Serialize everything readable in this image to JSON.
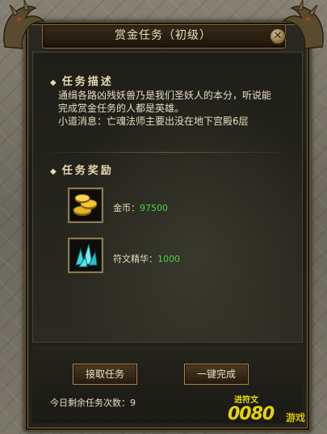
{
  "window": {
    "title": "赏金任务（初级）",
    "close_glyph": "✕"
  },
  "description": {
    "header": "任务描述",
    "lines": [
      "通缉各路凶残妖兽乃是我们圣妖人的本分，听说能",
      "完成赏金任务的人都是英雄。",
      "小道消息：亡魂法师主要出没在地下宫殿6层"
    ]
  },
  "rewards": {
    "header": "任务奖励",
    "items": [
      {
        "icon": "gold-coins-icon",
        "label": "金币：",
        "value": "97500"
      },
      {
        "icon": "rune-crystal-icon",
        "label": "符文精华：",
        "value": "1000"
      }
    ]
  },
  "buttons": {
    "accept": "接取任务",
    "instant_complete": "一键完成"
  },
  "status": {
    "remaining_label": "今日剩余任务次数：",
    "remaining_value": "9"
  },
  "watermark": {
    "sub": "进符文",
    "main": "0080",
    "suffix": "游戏"
  },
  "colors": {
    "accent_gold": "#b08a48",
    "reward_value": "#4ad24a",
    "text": "#e6dcc2"
  }
}
